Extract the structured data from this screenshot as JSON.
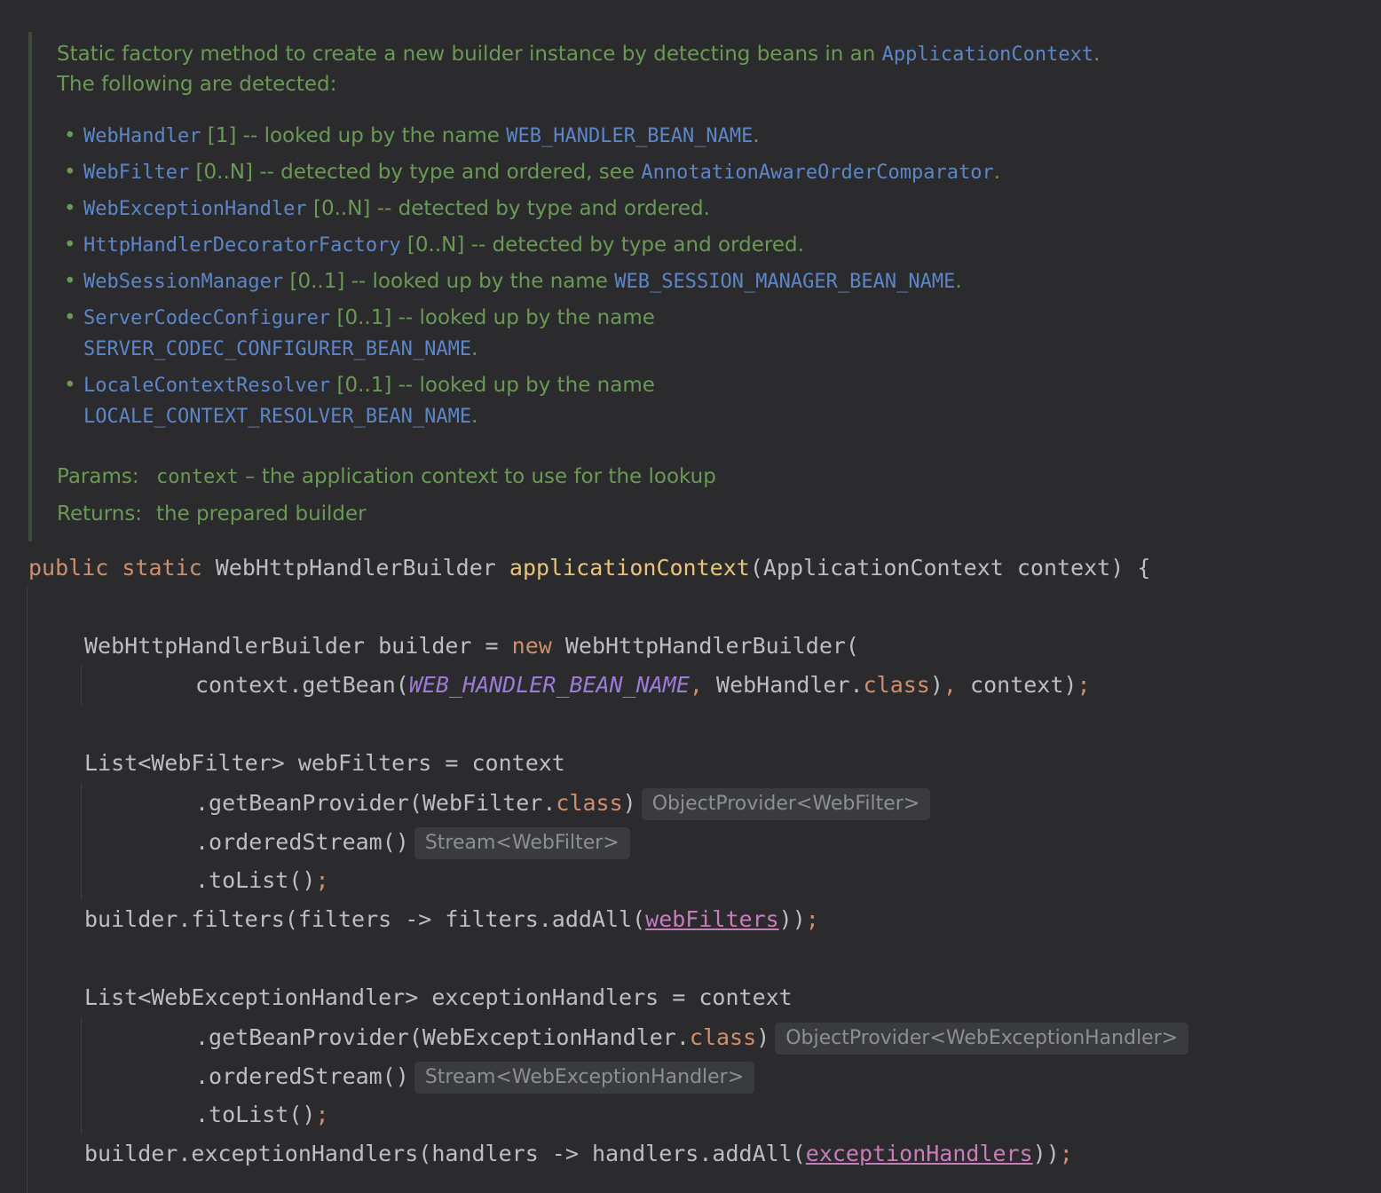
{
  "doc": {
    "intro_1": "Static factory method to create a new builder instance by detecting beans in an ",
    "intro_link": "ApplicationContext",
    "intro_1_end": ".",
    "intro_2": "The following are detected:",
    "items": [
      {
        "code": "WebHandler",
        "text": " [1] -- looked up by the name ",
        "ref": "WEB_HANDLER_BEAN_NAME",
        "end": "."
      },
      {
        "code": "WebFilter",
        "text": " [0..N] -- detected by type and ordered, see ",
        "ref": "AnnotationAwareOrderComparator",
        "end": "."
      },
      {
        "code": "WebExceptionHandler",
        "text": " [0..N] -- detected by type and ordered.",
        "ref": "",
        "end": ""
      },
      {
        "code": "HttpHandlerDecoratorFactory",
        "text": " [0..N] -- detected by type and ordered.",
        "ref": "",
        "end": ""
      },
      {
        "code": "WebSessionManager",
        "text": " [0..1] -- looked up by the name ",
        "ref": "WEB_SESSION_MANAGER_BEAN_NAME",
        "end": "."
      },
      {
        "code": "ServerCodecConfigurer",
        "text": " [0..1] -- looked up by the name",
        "ref": "SERVER_CODEC_CONFIGURER_BEAN_NAME",
        "end": "."
      },
      {
        "code": "LocaleContextResolver",
        "text": " [0..1] -- looked up by the name",
        "ref": "LOCALE_CONTEXT_RESOLVER_BEAN_NAME",
        "end": "."
      }
    ],
    "params_label": "Params:",
    "params_name": "context",
    "params_desc": " – the application context to use for the lookup",
    "returns_label": "Returns:",
    "returns_desc": "the prepared builder"
  },
  "code": {
    "sig_public": "public",
    "sig_static": "static",
    "sig_type": "WebHttpHandlerBuilder",
    "sig_name": "applicationContext",
    "sig_params": "(ApplicationContext context) {",
    "l1_a": "WebHttpHandlerBuilder builder = ",
    "l1_new": "new",
    "l1_b": " WebHttpHandlerBuilder(",
    "l2_a": "context.getBean(",
    "l2_const": "WEB_HANDLER_BEAN_NAME",
    "l2_comma": ",",
    "l2_b": " WebHandler.",
    "l2_class": "class",
    "l2_c": ")",
    "l2_comma2": ",",
    "l2_d": " context)",
    "l2_semi": ";",
    "l3": "List<WebFilter> webFilters = context",
    "l4_a": ".getBeanProvider(WebFilter.",
    "l4_class": "class",
    "l4_b": ")",
    "l4_hint": "ObjectProvider<WebFilter>",
    "l5_a": ".orderedStream()",
    "l5_hint": "Stream<WebFilter>",
    "l6_a": ".toList()",
    "l6_semi": ";",
    "l7_a": "builder.filters(filters -> filters.addAll(",
    "l7_var": "webFilters",
    "l7_b": "))",
    "l7_semi": ";",
    "l8": "List<WebExceptionHandler> exceptionHandlers = context",
    "l9_a": ".getBeanProvider(WebExceptionHandler.",
    "l9_class": "class",
    "l9_b": ")",
    "l9_hint": "ObjectProvider<WebExceptionHandler>",
    "l10_a": ".orderedStream()",
    "l10_hint": "Stream<WebExceptionHandler>",
    "l11_a": ".toList()",
    "l11_semi": ";",
    "l12_a": "builder.exceptionHandlers(handlers -> handlers.addAll(",
    "l12_var": "exceptionHandlers",
    "l12_b": "))",
    "l12_semi": ";"
  },
  "colors": {
    "background": "#2b2b2d",
    "doc_text": "#6a9955",
    "doc_link": "#5c86c8",
    "keyword": "#cf8e6d",
    "method_decl": "#e8c47a",
    "constant": "#9c7ad8",
    "reassigned_var": "#c77dbb"
  }
}
